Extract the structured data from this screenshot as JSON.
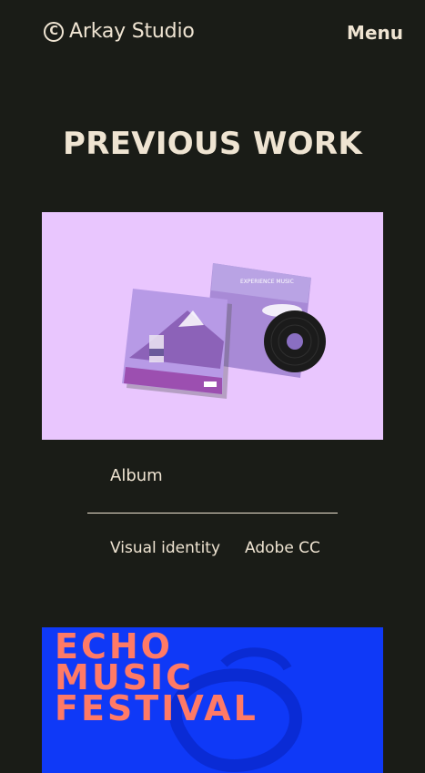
{
  "header": {
    "logo_symbol": "©",
    "logo_text": "Arkay Studio",
    "menu_label": "Menu"
  },
  "section": {
    "title": "PREVIOUS WORK"
  },
  "projects": [
    {
      "title": "Album",
      "tags": [
        "Visual identity",
        "Adobe CC"
      ],
      "cover_text": "EXPERIENCE MUSIC",
      "image_color": "#e9c6fe"
    },
    {
      "image_lines": [
        "ECHO",
        "MUSIC",
        "FESTIVAL"
      ],
      "image_color": "#0f39f7",
      "text_color": "#ff7a66"
    }
  ],
  "colors": {
    "background": "#1a1c17",
    "text": "#efe4d2"
  }
}
